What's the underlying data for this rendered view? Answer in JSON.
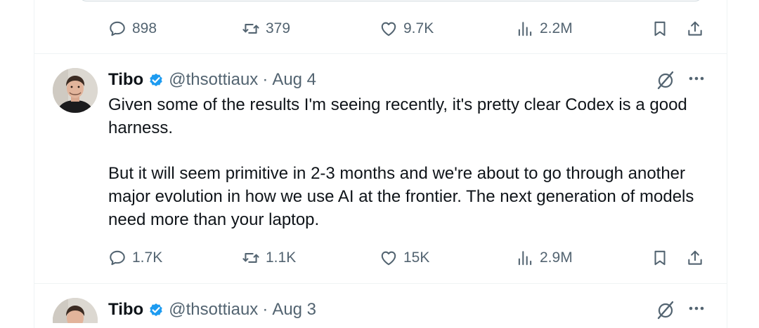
{
  "top_stats": {
    "replies": "898",
    "reposts": "379",
    "likes": "9.7K",
    "views": "2.2M"
  },
  "tweets": [
    {
      "name": "Tibo",
      "handle": "@thsottiaux",
      "separator": "·",
      "date": "Aug 4",
      "paragraphs": [
        "Given some of the results I'm seeing recently, it's pretty clear Codex is a good harness.",
        "But it will seem primitive in 2-3 months and we're about to go through another major evolution in how we use AI at the frontier. The next generation of models need more than your laptop."
      ],
      "stats": {
        "replies": "1.7K",
        "reposts": "1.1K",
        "likes": "15K",
        "views": "2.9M"
      }
    },
    {
      "name": "Tibo",
      "handle": "@thsottiaux",
      "separator": "·",
      "date": "Aug 3"
    }
  ],
  "icons": {
    "reply": "reply-icon",
    "repost": "repost-icon",
    "like": "heart-icon",
    "views": "views-icon",
    "bookmark": "bookmark-icon",
    "share": "share-icon",
    "verified": "verified-badge-icon",
    "grok": "grok-icon",
    "more": "more-icon"
  },
  "colors": {
    "text": "#0f1419",
    "secondary": "#536471",
    "verified": "#1d9bf0",
    "divider": "#eff3f4"
  }
}
